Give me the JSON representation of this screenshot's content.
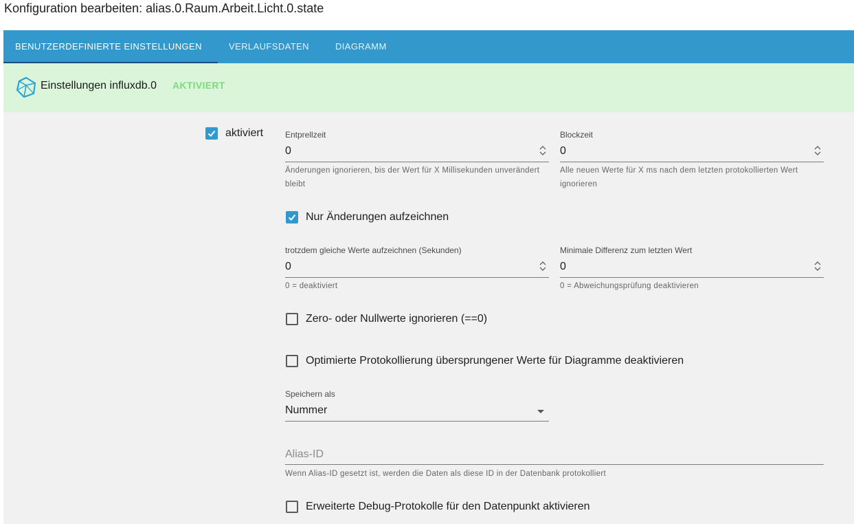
{
  "title": "Konfiguration bearbeiten: alias.0.Raum.Arbeit.Licht.0.state",
  "tabs": [
    {
      "label": "Benutzerdefinierte Einstellungen",
      "active": true
    },
    {
      "label": "Verlaufsdaten",
      "active": false
    },
    {
      "label": "Diagramm",
      "active": false
    }
  ],
  "banner": {
    "icon": "influxdb-icon",
    "text": "Einstellungen influxdb.0",
    "status": "AKTIVIERT",
    "status_color": "#7fd97f",
    "background": "#daf5da"
  },
  "settings": {
    "enabled": {
      "label": "aktiviert",
      "checked": true
    },
    "debounce": {
      "label": "Entprellzeit",
      "value": "0",
      "helper": "Änderungen ignorieren, bis der Wert für X Millisekunden unverändert bleibt"
    },
    "blocktime": {
      "label": "Blockzeit",
      "value": "0",
      "helper": "Alle neuen Werte für X ms nach dem letzten protokollierten Wert ignorieren"
    },
    "changes_only": {
      "label": "Nur Änderungen aufzeichnen",
      "checked": true
    },
    "changes_relog": {
      "label": "trotzdem gleiche Werte aufzeichnen (Sekunden)",
      "value": "0",
      "helper": "0 = deaktiviert"
    },
    "changes_min_delta": {
      "label": "Minimale Differenz zum letzten Wert",
      "value": "0",
      "helper": "0 = Abweichungsprüfung deaktivieren"
    },
    "ignore_zero": {
      "label": "Zero- oder Nullwerte ignorieren (==0)",
      "checked": false
    },
    "disable_skipped": {
      "label": "Optimierte Protokollierung übersprungener Werte für Diagramme deaktivieren",
      "checked": false
    },
    "storage_type": {
      "label": "Speichern als",
      "value": "Nummer"
    },
    "alias_id": {
      "placeholder": "Alias-ID",
      "helper": "Wenn Alias-ID gesetzt ist, werden die Daten als diese ID in der Datenbank protokolliert"
    },
    "debug": {
      "label": "Erweiterte Debug-Protokolle für den Datenpunkt aktivieren",
      "checked": false
    }
  },
  "colors": {
    "accent": "#3399cc",
    "panel": "#f1f1f1"
  }
}
